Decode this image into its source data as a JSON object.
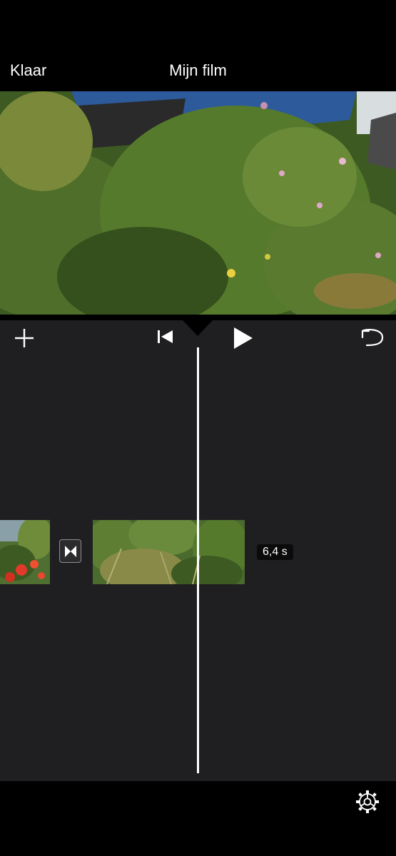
{
  "header": {
    "done_label": "Klaar",
    "title": "Mijn film"
  },
  "toolbar": {
    "add_icon": "plus-icon",
    "skip_back_icon": "skip-to-start-icon",
    "play_icon": "play-icon",
    "undo_icon": "undo-icon"
  },
  "timeline": {
    "transition_icon": "transition-icon",
    "clip_duration": "6,4 s"
  },
  "footer": {
    "settings_icon": "gear-icon"
  },
  "colors": {
    "background": "#000000",
    "editor": "#1f1f21",
    "playhead": "#ffffff"
  }
}
